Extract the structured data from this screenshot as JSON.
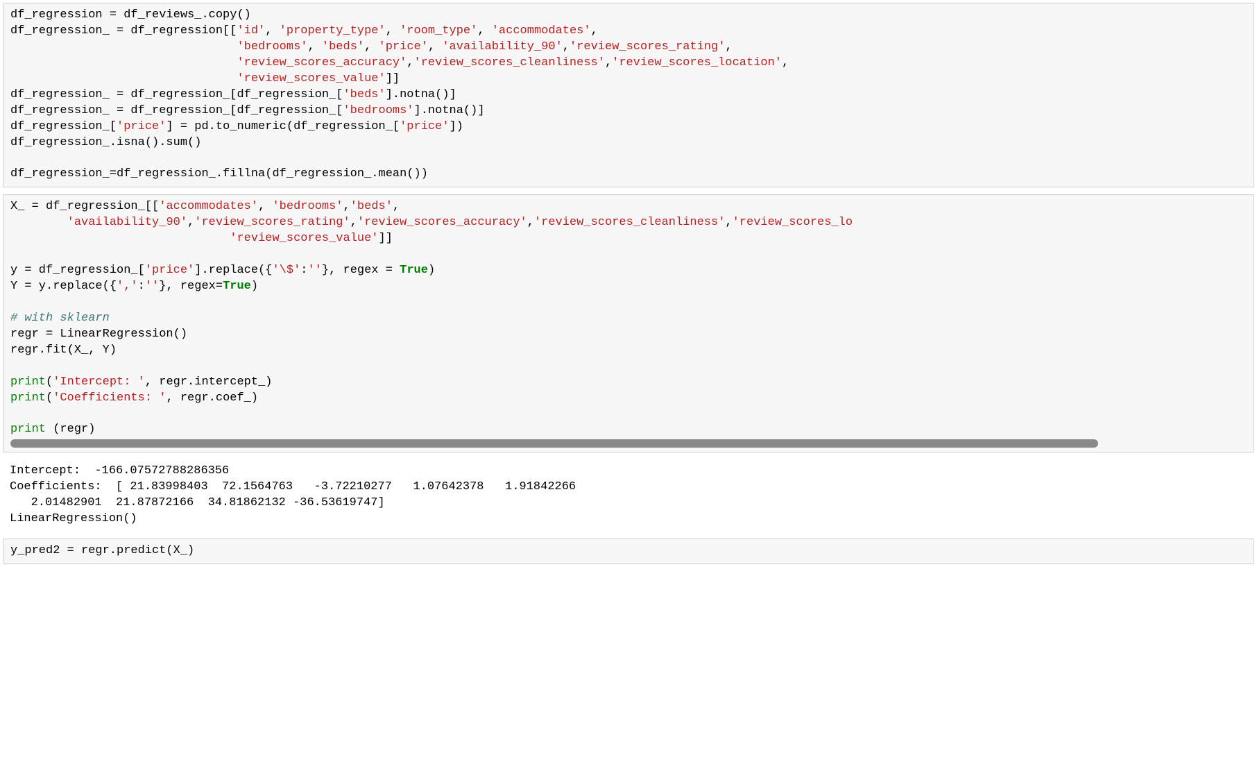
{
  "cell1": {
    "l1a": "df_regression = df_reviews_.copy()",
    "l2a": "df_regression_ = df_regression[[",
    "l2s": "'id'",
    "l2c1": ", ",
    "l2s2": "'property_type'",
    "l2c2": ", ",
    "l2s3": "'room_type'",
    "l2c3": ", ",
    "l2s4": "'accommodates'",
    "l2e": ",",
    "l3pad": "                                ",
    "l3s1": "'bedrooms'",
    "l3c1": ", ",
    "l3s2": "'beds'",
    "l3c2": ", ",
    "l3s3": "'price'",
    "l3c3": ", ",
    "l3s4": "'availability_90'",
    "l3c4": ",",
    "l3s5": "'review_scores_rating'",
    "l3e": ",",
    "l4s1": "'review_scores_accuracy'",
    "l4c1": ",",
    "l4s2": "'review_scores_cleanliness'",
    "l4c2": ",",
    "l4s3": "'review_scores_location'",
    "l4e": ",",
    "l5s1": "'review_scores_value'",
    "l5e": "]]",
    "l6a": "df_regression_ = df_regression_[df_regression_[",
    "l6s": "'beds'",
    "l6b": "].notna()]",
    "l7a": "df_regression_ = df_regression_[df_regression_[",
    "l7s": "'bedrooms'",
    "l7b": "].notna()]",
    "l8a": "df_regression_[",
    "l8s1": "'price'",
    "l8b": "] = pd.to_numeric(df_regression_[",
    "l8s2": "'price'",
    "l8c": "])",
    "l9": "df_regression_.isna().sum()",
    "l10": "df_regression_=df_regression_.fillna(df_regression_.mean())"
  },
  "cell2": {
    "l1a": "X_ = df_regression_[[",
    "l1s1": "'accommodates'",
    "l1c1": ", ",
    "l1s2": "'bedrooms'",
    "l1c2": ",",
    "l1s3": "'beds'",
    "l1e": ",",
    "l2pad": "        ",
    "l2s1": "'availability_90'",
    "l2c1": ",",
    "l2s2": "'review_scores_rating'",
    "l2c2": ",",
    "l2s3": "'review_scores_accuracy'",
    "l2c3": ",",
    "l2s4": "'review_scores_cleanliness'",
    "l2c4": ",",
    "l2s5": "'review_scores_lo",
    "l3pad": "                               ",
    "l3s1": "'review_scores_value'",
    "l3e": "]]",
    "l4a": "y = df_regression_[",
    "l4s1": "'price'",
    "l4b": "].replace({",
    "l4s2": "'\\$'",
    "l4c": ":",
    "l4s3": "''",
    "l4d": "}, regex = ",
    "l4kw": "True",
    "l4e": ")",
    "l5a": "Y = y.replace({",
    "l5s1": "','",
    "l5b": ":",
    "l5s2": "''",
    "l5c": "}, regex=",
    "l5kw": "True",
    "l5e": ")",
    "l6": "# with sklearn",
    "l7": "regr = LinearRegression()",
    "l8": "regr.fit(X_, Y)",
    "l9a": "print",
    "l9b": "(",
    "l9s": "'Intercept: '",
    "l9c": ", regr.intercept_)",
    "l10a": "print",
    "l10b": "(",
    "l10s": "'Coefficients: '",
    "l10c": ", regr.coef_)",
    "l11a": "print",
    "l11b": " (regr)"
  },
  "output": {
    "l1": "Intercept:  -166.07572788286356",
    "l2": "Coefficients:  [ 21.83998403  72.1564763   -3.72210277   1.07642378   1.91842266",
    "l3": "   2.01482901  21.87872166  34.81862132 -36.53619747]",
    "l4": "LinearRegression()"
  },
  "cell3": {
    "l1": "y_pred2 = regr.predict(X_)"
  }
}
